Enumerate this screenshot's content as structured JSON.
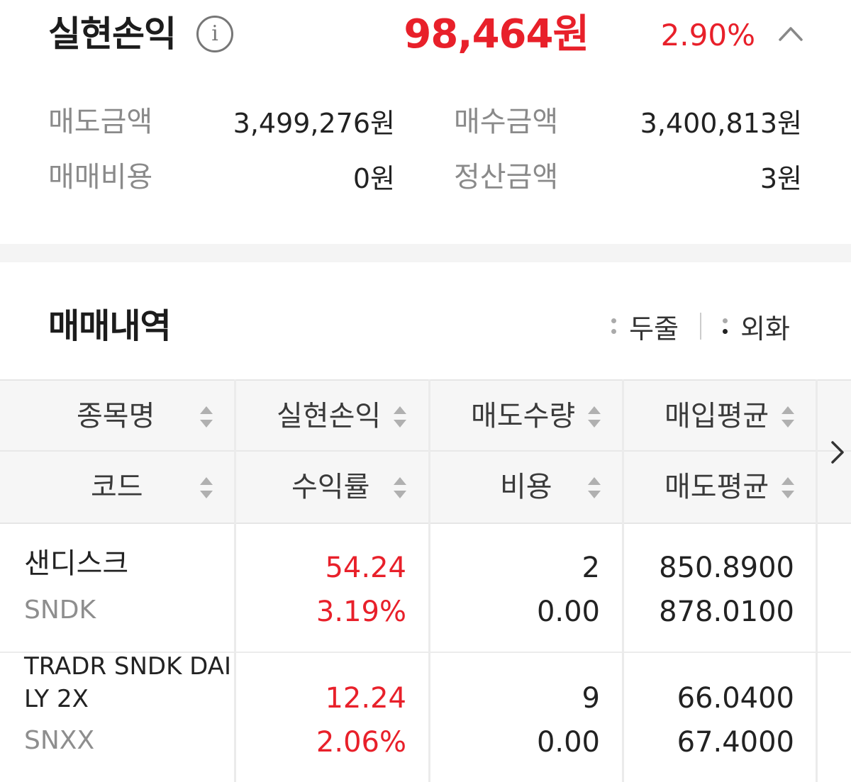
{
  "summary": {
    "title": "실현손익",
    "info_icon": "info-circle-icon",
    "profit_amount": "98,464원",
    "profit_rate": "2.90%",
    "collapse_icon": "chevron-up-icon",
    "accent_color": "#e8202a",
    "details": {
      "sell_amount_label": "매도금액",
      "sell_amount_value": "3,499,276원",
      "buy_amount_label": "매수금액",
      "buy_amount_value": "3,400,813원",
      "trade_cost_label": "매매비용",
      "trade_cost_value": "0원",
      "settlement_label": "정산금액",
      "settlement_value": "3원"
    }
  },
  "history": {
    "title": "매매내역",
    "options": [
      {
        "label": "두줄",
        "icon": "more-vert-icon"
      },
      {
        "label": "외화",
        "icon": "more-vert-icon"
      }
    ],
    "headers": {
      "row1": [
        "종목명",
        "실현손익",
        "매도수량",
        "매입평균"
      ],
      "row2": [
        "코드",
        "수익률",
        "비용",
        "매도평균"
      ]
    },
    "scroll_icon": "chevron-right-icon",
    "rows": [
      {
        "name_line1": "샌디스크",
        "name_line2": "",
        "code": "SNDK",
        "realized_pnl": "54.24",
        "return_rate": "3.19%",
        "sell_qty": "2",
        "cost": "0.00",
        "avg_buy": "850.8900",
        "avg_sell": "878.0100"
      },
      {
        "name_line1": "TRADR SNDK DAI",
        "name_line2": "LY 2X",
        "code": "SNXX",
        "realized_pnl": "12.24",
        "return_rate": "2.06%",
        "sell_qty": "9",
        "cost": "0.00",
        "avg_buy": "66.0400",
        "avg_sell": "67.4000"
      }
    ]
  }
}
